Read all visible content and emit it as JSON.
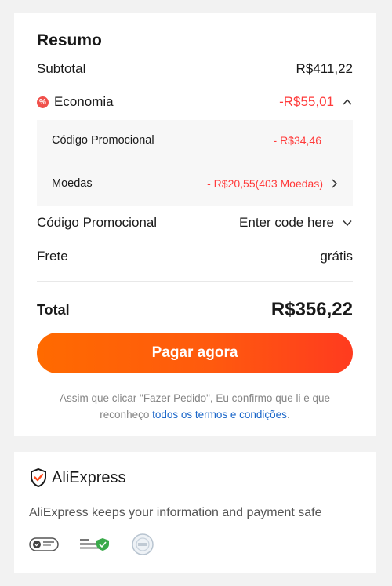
{
  "summary": {
    "title": "Resumo",
    "subtotal_label": "Subtotal",
    "subtotal_value": "R$411,22",
    "savings_label": "Economia",
    "savings_value": "-R$55,01",
    "savings_items": [
      {
        "label": "Código Promocional",
        "value": "- R$34,46"
      },
      {
        "label": "Moedas",
        "value": "- R$20,55(403 Moedas)"
      }
    ],
    "promo_label": "Código Promocional",
    "promo_placeholder": "Enter code here",
    "shipping_label": "Frete",
    "shipping_value": "grátis",
    "total_label": "Total",
    "total_value": "R$356,22",
    "pay_button_label": "Pagar agora",
    "terms_text": "Assim que clicar \"Fazer Pedido\", Eu confirmo que li e que reconheço ",
    "terms_link": "todos os termos e condições",
    "terms_end": "."
  },
  "safety": {
    "brand": "AliExpress",
    "message": "AliExpress keeps your information and payment safe",
    "badges": [
      "visa-secure-icon",
      "security-certified-icon",
      "pci-dss-icon"
    ]
  },
  "colors": {
    "accent": "#ff5a0e",
    "discount": "#ff3b3b",
    "link": "#1a66c9"
  }
}
